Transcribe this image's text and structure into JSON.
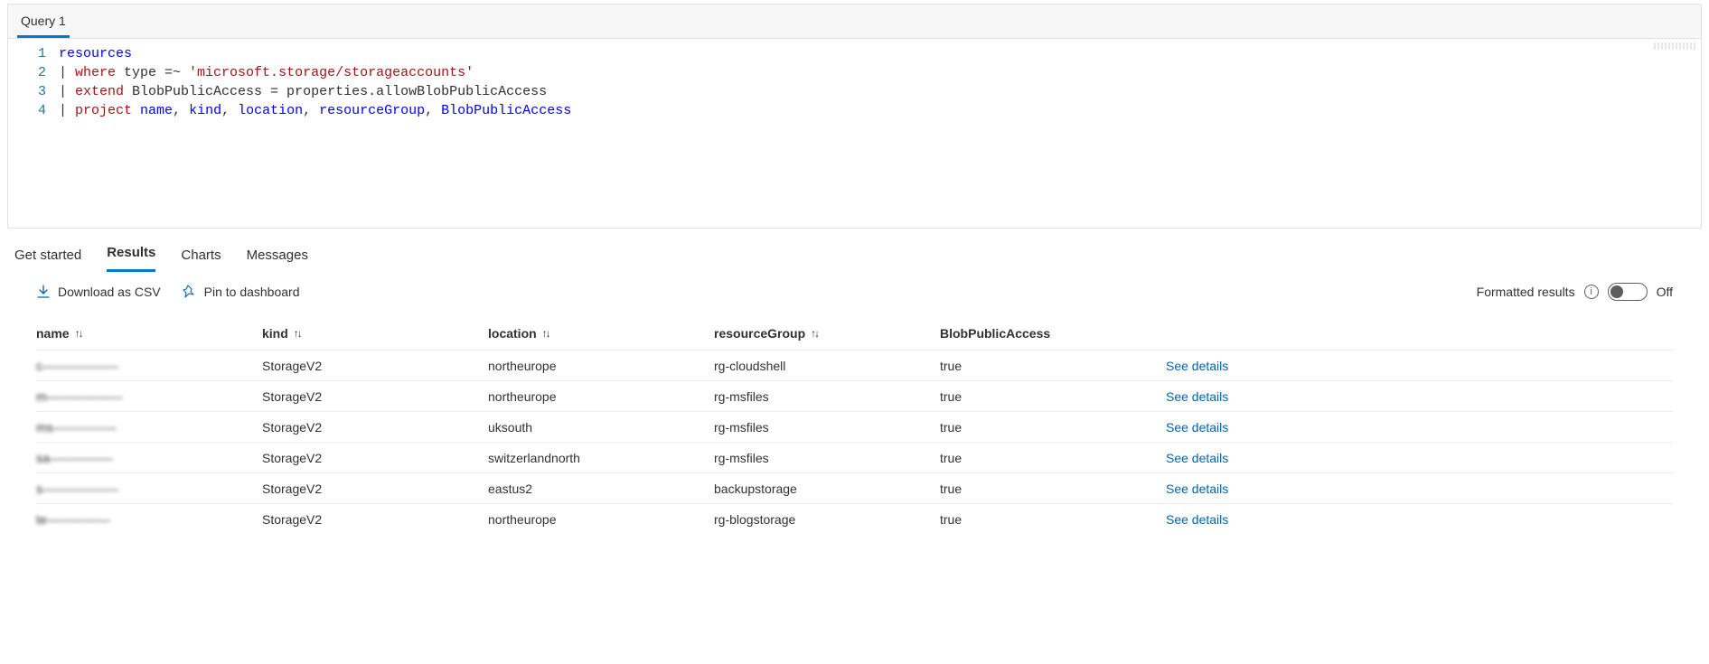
{
  "editor": {
    "tab_label": "Query 1",
    "line_numbers": [
      "1",
      "2",
      "3",
      "4"
    ],
    "lines": {
      "l1": {
        "a": "resources"
      },
      "l2": {
        "a": "| ",
        "b": "where",
        "c": " type =~ ",
        "d": "'microsoft.storage/storageaccounts'"
      },
      "l3": {
        "a": "| ",
        "b": "extend",
        "c": " BlobPublicAccess = properties",
        "d": ".allowBlobPublicAccess"
      },
      "l4": {
        "a": "| ",
        "b": "project",
        "c": " name",
        "d": ", ",
        "e": "kind",
        "f": ", ",
        "g": "location",
        "h": ", ",
        "i": "resourceGroup",
        "j": ", ",
        "k": "BlobPublicAccess"
      }
    }
  },
  "result_tabs": {
    "get_started": "Get started",
    "results": "Results",
    "charts": "Charts",
    "messages": "Messages"
  },
  "toolbar": {
    "download_csv": "Download as CSV",
    "pin_dashboard": "Pin to dashboard",
    "formatted_results": "Formatted results",
    "toggle_state_label": "Off"
  },
  "columns": {
    "name": "name",
    "kind": "kind",
    "location": "location",
    "resourceGroup": "resourceGroup",
    "blobPublicAccess": "BlobPublicAccess"
  },
  "link_label": "See details",
  "rows": [
    {
      "name": "c——————",
      "kind": "StorageV2",
      "location": "northeurope",
      "resourceGroup": "rg-cloudshell",
      "blobPublicAccess": "true"
    },
    {
      "name": "m——————",
      "kind": "StorageV2",
      "location": "northeurope",
      "resourceGroup": "rg-msfiles",
      "blobPublicAccess": "true"
    },
    {
      "name": "ms—————",
      "kind": "StorageV2",
      "location": "uksouth",
      "resourceGroup": "rg-msfiles",
      "blobPublicAccess": "true"
    },
    {
      "name": "sa—————",
      "kind": "StorageV2",
      "location": "switzerlandnorth",
      "resourceGroup": "rg-msfiles",
      "blobPublicAccess": "true"
    },
    {
      "name": "s——————",
      "kind": "StorageV2",
      "location": "eastus2",
      "resourceGroup": "backupstorage",
      "blobPublicAccess": "true"
    },
    {
      "name": "te—————",
      "kind": "StorageV2",
      "location": "northeurope",
      "resourceGroup": "rg-blogstorage",
      "blobPublicAccess": "true"
    }
  ]
}
